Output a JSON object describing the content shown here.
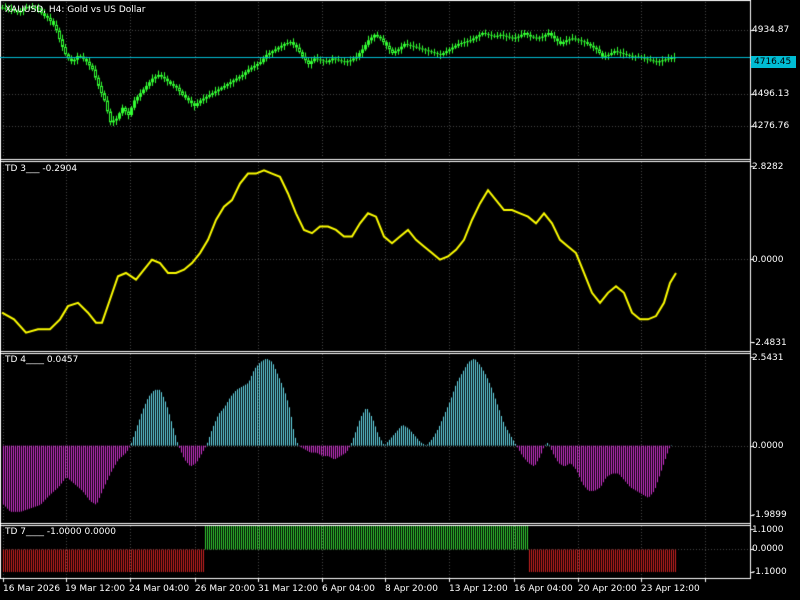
{
  "window": {
    "symbol_title": "XAUUSD, H4:  Gold vs US Dollar"
  },
  "colors": {
    "background": "#000000",
    "grid": "#4a4a4a",
    "separator": "#ffffff",
    "bull_candle": "#33ff33",
    "bear_candle": "#000000",
    "wick": "#33ff33",
    "bid_line": "#00bcd4",
    "td3_line": "#ffff00",
    "td4_positive": "#66d9e8",
    "td4_negative": "#cc33cc",
    "td7_positive": "#33cc33",
    "td7_negative": "#cc2222"
  },
  "main_pane": {
    "price_axis": [
      "4934.87",
      "4496.13",
      "4276.76"
    ],
    "current_price": "4716.45"
  },
  "td3_pane": {
    "title": "TD 3___  -0.2904",
    "axis": [
      "2.8282",
      "0.0000",
      "-2.4831"
    ]
  },
  "td4_pane": {
    "title": "TD 4____  0.0457",
    "axis": [
      "2.5431",
      "0.0000",
      "-1.9899"
    ]
  },
  "td7_pane": {
    "title": "TD 7____ -1.0000 0.0000",
    "axis": [
      "1.1000",
      "0.0000",
      "-1.1000"
    ]
  },
  "time_axis": [
    "16 Mar 2026",
    "19 Mar 12:00",
    "24 Mar 04:00",
    "26 Mar 20:00",
    "31 Mar 12:00",
    "6 Apr 04:00",
    "8 Apr 20:00",
    "13 Apr 12:00",
    "16 Apr 04:00",
    "20 Apr 20:00",
    "23 Apr 12:00"
  ],
  "chart_data": {
    "type": "candlestick",
    "price_range": [
      4170,
      5020
    ],
    "bid_price": 4716.45,
    "close_path": [
      [
        0,
        4990
      ],
      [
        6,
        4985
      ],
      [
        12,
        4975
      ],
      [
        18,
        4960
      ],
      [
        24,
        4990
      ],
      [
        30,
        4995
      ],
      [
        38,
        4985
      ],
      [
        42,
        4950
      ],
      [
        48,
        4930
      ],
      [
        55,
        4880
      ],
      [
        60,
        4800
      ],
      [
        66,
        4720
      ],
      [
        72,
        4690
      ],
      [
        78,
        4730
      ],
      [
        85,
        4700
      ],
      [
        92,
        4650
      ],
      [
        98,
        4560
      ],
      [
        104,
        4480
      ],
      [
        110,
        4360
      ],
      [
        116,
        4380
      ],
      [
        122,
        4440
      ],
      [
        128,
        4400
      ],
      [
        134,
        4480
      ],
      [
        140,
        4520
      ],
      [
        146,
        4560
      ],
      [
        152,
        4600
      ],
      [
        158,
        4620
      ],
      [
        164,
        4600
      ],
      [
        170,
        4570
      ],
      [
        176,
        4550
      ],
      [
        182,
        4510
      ],
      [
        188,
        4480
      ],
      [
        194,
        4450
      ],
      [
        200,
        4480
      ],
      [
        206,
        4500
      ],
      [
        212,
        4520
      ],
      [
        218,
        4540
      ],
      [
        224,
        4560
      ],
      [
        230,
        4580
      ],
      [
        236,
        4600
      ],
      [
        242,
        4620
      ],
      [
        248,
        4650
      ],
      [
        254,
        4670
      ],
      [
        260,
        4690
      ],
      [
        266,
        4730
      ],
      [
        272,
        4750
      ],
      [
        278,
        4770
      ],
      [
        284,
        4790
      ],
      [
        290,
        4800
      ],
      [
        296,
        4770
      ],
      [
        302,
        4720
      ],
      [
        308,
        4680
      ],
      [
        314,
        4710
      ],
      [
        320,
        4700
      ],
      [
        326,
        4690
      ],
      [
        332,
        4710
      ],
      [
        338,
        4700
      ],
      [
        344,
        4690
      ],
      [
        350,
        4700
      ],
      [
        356,
        4720
      ],
      [
        362,
        4760
      ],
      [
        368,
        4810
      ],
      [
        374,
        4840
      ],
      [
        380,
        4820
      ],
      [
        386,
        4780
      ],
      [
        392,
        4740
      ],
      [
        398,
        4760
      ],
      [
        404,
        4790
      ],
      [
        410,
        4780
      ],
      [
        416,
        4770
      ],
      [
        422,
        4760
      ],
      [
        428,
        4750
      ],
      [
        434,
        4740
      ],
      [
        440,
        4730
      ],
      [
        446,
        4750
      ],
      [
        452,
        4770
      ],
      [
        458,
        4790
      ],
      [
        464,
        4800
      ],
      [
        470,
        4810
      ],
      [
        476,
        4830
      ],
      [
        482,
        4850
      ],
      [
        488,
        4840
      ],
      [
        494,
        4830
      ],
      [
        500,
        4840
      ],
      [
        506,
        4830
      ],
      [
        512,
        4820
      ],
      [
        518,
        4830
      ],
      [
        524,
        4850
      ],
      [
        530,
        4830
      ],
      [
        536,
        4820
      ],
      [
        542,
        4830
      ],
      [
        548,
        4850
      ],
      [
        554,
        4820
      ],
      [
        560,
        4790
      ],
      [
        566,
        4810
      ],
      [
        572,
        4820
      ],
      [
        578,
        4810
      ],
      [
        584,
        4800
      ],
      [
        590,
        4780
      ],
      [
        596,
        4760
      ],
      [
        602,
        4720
      ],
      [
        608,
        4730
      ],
      [
        614,
        4750
      ],
      [
        620,
        4740
      ],
      [
        626,
        4730
      ],
      [
        632,
        4720
      ],
      [
        638,
        4720
      ],
      [
        644,
        4710
      ],
      [
        650,
        4700
      ],
      [
        656,
        4690
      ],
      [
        662,
        4700
      ],
      [
        668,
        4710
      ],
      [
        674,
        4716
      ]
    ],
    "td3_range": [
      -2.4831,
      2.8282
    ],
    "td3_points": [
      [
        0,
        -1.6
      ],
      [
        12,
        -1.8
      ],
      [
        24,
        -2.2
      ],
      [
        36,
        -2.1
      ],
      [
        48,
        -2.1
      ],
      [
        58,
        -1.8
      ],
      [
        66,
        -1.4
      ],
      [
        76,
        -1.3
      ],
      [
        86,
        -1.6
      ],
      [
        94,
        -1.9
      ],
      [
        100,
        -1.9
      ],
      [
        108,
        -1.2
      ],
      [
        116,
        -0.5
      ],
      [
        124,
        -0.4
      ],
      [
        134,
        -0.6
      ],
      [
        142,
        -0.3
      ],
      [
        150,
        0.0
      ],
      [
        158,
        -0.1
      ],
      [
        166,
        -0.4
      ],
      [
        174,
        -0.4
      ],
      [
        182,
        -0.3
      ],
      [
        190,
        -0.1
      ],
      [
        198,
        0.2
      ],
      [
        206,
        0.6
      ],
      [
        214,
        1.2
      ],
      [
        222,
        1.6
      ],
      [
        230,
        1.8
      ],
      [
        238,
        2.3
      ],
      [
        246,
        2.6
      ],
      [
        254,
        2.6
      ],
      [
        262,
        2.7
      ],
      [
        270,
        2.6
      ],
      [
        278,
        2.5
      ],
      [
        286,
        2.0
      ],
      [
        294,
        1.4
      ],
      [
        302,
        0.9
      ],
      [
        310,
        0.8
      ],
      [
        318,
        1.0
      ],
      [
        326,
        1.0
      ],
      [
        334,
        0.9
      ],
      [
        342,
        0.7
      ],
      [
        350,
        0.7
      ],
      [
        358,
        1.1
      ],
      [
        366,
        1.4
      ],
      [
        374,
        1.3
      ],
      [
        382,
        0.7
      ],
      [
        390,
        0.5
      ],
      [
        398,
        0.7
      ],
      [
        406,
        0.9
      ],
      [
        414,
        0.6
      ],
      [
        422,
        0.4
      ],
      [
        430,
        0.2
      ],
      [
        438,
        0.0
      ],
      [
        446,
        0.1
      ],
      [
        454,
        0.3
      ],
      [
        462,
        0.6
      ],
      [
        470,
        1.2
      ],
      [
        478,
        1.7
      ],
      [
        486,
        2.1
      ],
      [
        494,
        1.8
      ],
      [
        502,
        1.5
      ],
      [
        510,
        1.5
      ],
      [
        518,
        1.4
      ],
      [
        526,
        1.3
      ],
      [
        534,
        1.1
      ],
      [
        542,
        1.4
      ],
      [
        550,
        1.1
      ],
      [
        558,
        0.6
      ],
      [
        566,
        0.4
      ],
      [
        574,
        0.2
      ],
      [
        582,
        -0.4
      ],
      [
        590,
        -1.0
      ],
      [
        598,
        -1.3
      ],
      [
        606,
        -1.0
      ],
      [
        614,
        -0.8
      ],
      [
        622,
        -1.0
      ],
      [
        630,
        -1.6
      ],
      [
        638,
        -1.8
      ],
      [
        646,
        -1.8
      ],
      [
        654,
        -1.7
      ],
      [
        662,
        -1.3
      ],
      [
        668,
        -0.7
      ],
      [
        674,
        -0.4
      ]
    ],
    "td4_range": [
      -1.9899,
      2.5431
    ],
    "td4_points": [
      [
        0,
        -1.6
      ],
      [
        10,
        -1.9
      ],
      [
        20,
        -1.9
      ],
      [
        30,
        -1.8
      ],
      [
        40,
        -1.7
      ],
      [
        50,
        -1.4
      ],
      [
        58,
        -1.2
      ],
      [
        66,
        -0.9
      ],
      [
        74,
        -1.1
      ],
      [
        82,
        -1.3
      ],
      [
        90,
        -1.6
      ],
      [
        96,
        -1.7
      ],
      [
        102,
        -1.3
      ],
      [
        110,
        -0.8
      ],
      [
        118,
        -0.4
      ],
      [
        126,
        -0.2
      ],
      [
        130,
        0.0
      ],
      [
        136,
        0.5
      ],
      [
        142,
        1.0
      ],
      [
        148,
        1.4
      ],
      [
        154,
        1.6
      ],
      [
        160,
        1.6
      ],
      [
        166,
        1.2
      ],
      [
        172,
        0.6
      ],
      [
        178,
        0.0
      ],
      [
        184,
        -0.4
      ],
      [
        190,
        -0.6
      ],
      [
        196,
        -0.5
      ],
      [
        202,
        -0.2
      ],
      [
        206,
        0.0
      ],
      [
        212,
        0.5
      ],
      [
        218,
        0.9
      ],
      [
        224,
        1.1
      ],
      [
        230,
        1.4
      ],
      [
        236,
        1.6
      ],
      [
        242,
        1.7
      ],
      [
        248,
        1.8
      ],
      [
        254,
        2.2
      ],
      [
        260,
        2.4
      ],
      [
        266,
        2.5
      ],
      [
        272,
        2.4
      ],
      [
        278,
        2.0
      ],
      [
        284,
        1.6
      ],
      [
        290,
        1.0
      ],
      [
        294,
        0.3
      ],
      [
        298,
        0.0
      ],
      [
        304,
        -0.1
      ],
      [
        310,
        -0.2
      ],
      [
        316,
        -0.2
      ],
      [
        322,
        -0.3
      ],
      [
        328,
        -0.3
      ],
      [
        334,
        -0.4
      ],
      [
        340,
        -0.3
      ],
      [
        346,
        -0.2
      ],
      [
        350,
        0.0
      ],
      [
        354,
        0.3
      ],
      [
        360,
        0.8
      ],
      [
        366,
        1.1
      ],
      [
        372,
        0.8
      ],
      [
        378,
        0.3
      ],
      [
        384,
        0.0
      ],
      [
        390,
        0.2
      ],
      [
        396,
        0.4
      ],
      [
        402,
        0.6
      ],
      [
        408,
        0.5
      ],
      [
        414,
        0.3
      ],
      [
        420,
        0.1
      ],
      [
        426,
        0.0
      ],
      [
        432,
        0.2
      ],
      [
        438,
        0.5
      ],
      [
        444,
        0.9
      ],
      [
        450,
        1.3
      ],
      [
        456,
        1.8
      ],
      [
        462,
        2.1
      ],
      [
        468,
        2.4
      ],
      [
        474,
        2.5
      ],
      [
        480,
        2.3
      ],
      [
        486,
        2.0
      ],
      [
        492,
        1.6
      ],
      [
        498,
        1.1
      ],
      [
        504,
        0.6
      ],
      [
        510,
        0.3
      ],
      [
        516,
        0.0
      ],
      [
        522,
        -0.3
      ],
      [
        528,
        -0.5
      ],
      [
        534,
        -0.6
      ],
      [
        540,
        -0.3
      ],
      [
        544,
        0.0
      ],
      [
        548,
        0.1
      ],
      [
        552,
        -0.2
      ],
      [
        558,
        -0.5
      ],
      [
        564,
        -0.6
      ],
      [
        570,
        -0.5
      ],
      [
        576,
        -0.7
      ],
      [
        582,
        -1.1
      ],
      [
        588,
        -1.3
      ],
      [
        594,
        -1.3
      ],
      [
        600,
        -1.2
      ],
      [
        606,
        -0.9
      ],
      [
        612,
        -0.8
      ],
      [
        618,
        -0.8
      ],
      [
        624,
        -1.0
      ],
      [
        630,
        -1.2
      ],
      [
        636,
        -1.3
      ],
      [
        642,
        -1.4
      ],
      [
        648,
        -1.5
      ],
      [
        654,
        -1.3
      ],
      [
        660,
        -0.8
      ],
      [
        666,
        -0.3
      ],
      [
        670,
        0.0
      ],
      [
        674,
        0.05
      ]
    ],
    "td7_segments": [
      {
        "from": 0,
        "to": 203,
        "value": -1
      },
      {
        "from": 205,
        "to": 527,
        "value": 1
      },
      {
        "from": 528,
        "to": 675,
        "value": -1
      }
    ]
  }
}
